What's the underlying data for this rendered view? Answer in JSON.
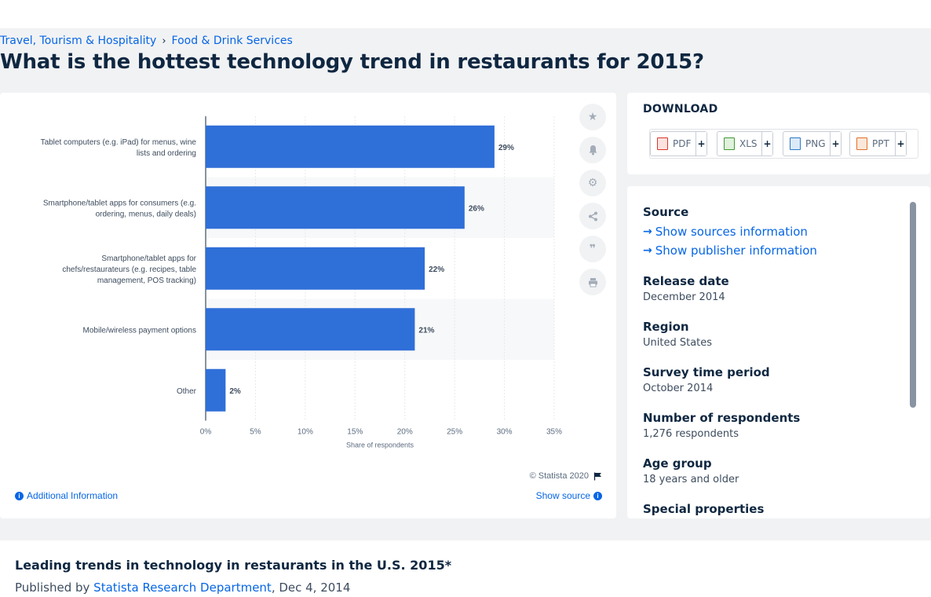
{
  "breadcrumb": {
    "items": [
      "Travel, Tourism & Hospitality",
      "Food & Drink Services"
    ],
    "separator": "›"
  },
  "page_title": "What is the hottest technology trend in restaurants for 2015?",
  "tools": [
    {
      "icon": "star-icon",
      "label": "Favorite"
    },
    {
      "icon": "bell-icon",
      "label": "Notification"
    },
    {
      "icon": "gear-icon",
      "label": "Settings"
    },
    {
      "icon": "share-icon",
      "label": "Share"
    },
    {
      "icon": "quote-icon",
      "label": "Cite"
    },
    {
      "icon": "print-icon",
      "label": "Print"
    }
  ],
  "chart_data": {
    "type": "bar",
    "orientation": "horizontal",
    "categories": [
      "Tablet computers (e.g. iPad) for menus, wine lists and ordering",
      "Smartphone/tablet apps for consumers (e.g. ordering, menus, daily deals)",
      "Smartphone/tablet apps for chefs/restaurateurs (e.g. recipes, table management, POS tracking)",
      "Mobile/wireless payment options",
      "Other"
    ],
    "category_lines": [
      [
        "Tablet computers (e.g. iPad) for menus, wine",
        "lists and ordering"
      ],
      [
        "Smartphone/tablet apps for consumers (e.g.",
        "ordering, menus, daily deals)"
      ],
      [
        "Smartphone/tablet apps for",
        "chefs/restaurateurs (e.g. recipes, table",
        "management, POS tracking)"
      ],
      [
        "Mobile/wireless payment options"
      ],
      [
        "Other"
      ]
    ],
    "values": [
      29,
      26,
      22,
      21,
      2
    ],
    "value_labels": [
      "29%",
      "26%",
      "22%",
      "21%",
      "2%"
    ],
    "xlabel": "Share of respondents",
    "xlim": [
      0,
      35
    ],
    "ticks": [
      0,
      5,
      10,
      15,
      20,
      25,
      30,
      35
    ],
    "tick_labels": [
      "0%",
      "5%",
      "10%",
      "15%",
      "20%",
      "25%",
      "30%",
      "35%"
    ],
    "grid": true,
    "bar_color": "#2f6fd8"
  },
  "chart_footer": {
    "copyright": "© Statista 2020",
    "additional": "Additional Information",
    "show_source": "Show source"
  },
  "download": {
    "title": "DOWNLOAD",
    "formats": [
      {
        "label": "PDF",
        "color": "#d9352b"
      },
      {
        "label": "XLS",
        "color": "#3f9a34"
      },
      {
        "label": "PNG",
        "color": "#2b79c9"
      },
      {
        "label": "PPT",
        "color": "#e0702b"
      }
    ],
    "plus": "+"
  },
  "info": {
    "source_label": "Source",
    "show_sources": "Show sources information",
    "show_publisher": "Show publisher information",
    "release_date_label": "Release date",
    "release_date": "December 2014",
    "region_label": "Region",
    "region": "United States",
    "survey_period_label": "Survey time period",
    "survey_period": "October 2014",
    "respondents_label": "Number of respondents",
    "respondents": "1,276 respondents",
    "age_group_label": "Age group",
    "age_group": "18 years and older",
    "special_label": "Special properties"
  },
  "bottom": {
    "title": "Leading trends in technology in restaurants in the U.S. 2015*",
    "published_prefix": "Published by",
    "department": "Statista Research Department",
    "date": ", Dec 4, 2014"
  }
}
